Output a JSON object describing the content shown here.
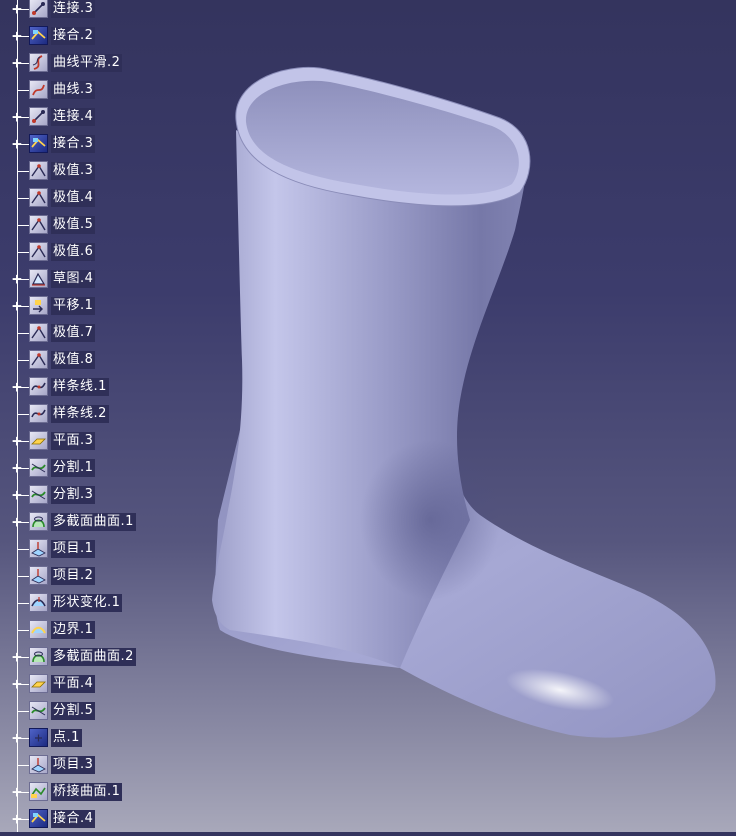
{
  "spec_tree": {
    "items": [
      {
        "label": "连接.3",
        "icon": "connect-icon",
        "expandable": true
      },
      {
        "label": "接合.2",
        "icon": "join-icon",
        "expandable": true
      },
      {
        "label": "曲线平滑.2",
        "icon": "curve-smooth-icon",
        "expandable": true
      },
      {
        "label": "曲线.3",
        "icon": "curve-icon",
        "expandable": false
      },
      {
        "label": "连接.4",
        "icon": "connect-icon",
        "expandable": true
      },
      {
        "label": "接合.3",
        "icon": "join-icon",
        "expandable": true
      },
      {
        "label": "极值.3",
        "icon": "extremum-icon",
        "expandable": false
      },
      {
        "label": "极值.4",
        "icon": "extremum-icon",
        "expandable": false
      },
      {
        "label": "极值.5",
        "icon": "extremum-icon",
        "expandable": false
      },
      {
        "label": "极值.6",
        "icon": "extremum-icon",
        "expandable": false
      },
      {
        "label": "草图.4",
        "icon": "sketch-icon",
        "expandable": true
      },
      {
        "label": "平移.1",
        "icon": "translate-icon",
        "expandable": true
      },
      {
        "label": "极值.7",
        "icon": "extremum-icon",
        "expandable": false
      },
      {
        "label": "极值.8",
        "icon": "extremum-icon",
        "expandable": false
      },
      {
        "label": "样条线.1",
        "icon": "spline-icon",
        "expandable": true
      },
      {
        "label": "样条线.2",
        "icon": "spline-icon",
        "expandable": false
      },
      {
        "label": "平面.3",
        "icon": "plane-icon",
        "expandable": true
      },
      {
        "label": "分割.1",
        "icon": "split-icon",
        "expandable": true
      },
      {
        "label": "分割.3",
        "icon": "split-icon",
        "expandable": true
      },
      {
        "label": "多截面曲面.1",
        "icon": "multisection-surface-icon",
        "expandable": true
      },
      {
        "label": "项目.1",
        "icon": "projection-icon",
        "expandable": false
      },
      {
        "label": "项目.2",
        "icon": "projection-icon",
        "expandable": false
      },
      {
        "label": "形状变化.1",
        "icon": "shape-morph-icon",
        "expandable": false
      },
      {
        "label": "边界.1",
        "icon": "boundary-icon",
        "expandable": false
      },
      {
        "label": "多截面曲面.2",
        "icon": "multisection-surface-icon",
        "expandable": true
      },
      {
        "label": "平面.4",
        "icon": "plane-icon",
        "expandable": true
      },
      {
        "label": "分割.5",
        "icon": "split-icon",
        "expandable": false
      },
      {
        "label": "点.1",
        "icon": "point-icon",
        "expandable": true
      },
      {
        "label": "项目.3",
        "icon": "projection-icon",
        "expandable": false
      },
      {
        "label": "桥接曲面.1",
        "icon": "blend-surface-icon",
        "expandable": true
      },
      {
        "label": "接合.4",
        "icon": "join-icon",
        "expandable": true
      }
    ]
  },
  "viewport": {
    "model": "boot-surface-model",
    "background_top": "#34345e",
    "background_bottom": "#a8a8ba",
    "surface_color": "#a9abd6"
  }
}
